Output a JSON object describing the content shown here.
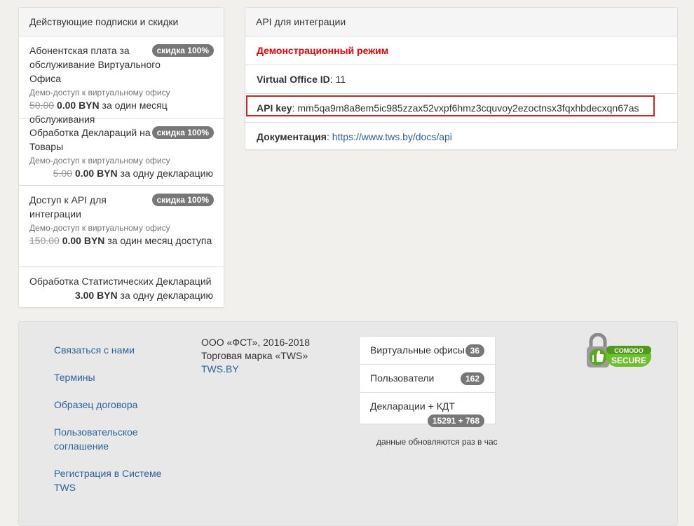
{
  "subscriptions": {
    "heading": "Действующие подписки и скидки",
    "items": [
      {
        "title": "Абонентская плата за обслуживание Виртуального Офиса",
        "badge": "скидка 100%",
        "note": "Демо-доступ к виртуальному офису",
        "old_price": "50.00",
        "new_price": "0.00 BYN",
        "period": "за один месяц обслуживания"
      },
      {
        "title": "Обработка Деклараций на Товары",
        "badge": "скидка 100%",
        "note": "Демо-доступ к виртуальному офису",
        "old_price": "5.00",
        "new_price": "0.00 BYN",
        "period": "за одну декларацию"
      },
      {
        "title": "Доступ к API для интеграции",
        "badge": "скидка 100%",
        "note": "Демо-доступ к виртуальному офису",
        "old_price": "150.00",
        "new_price": "0.00 BYN",
        "period": "за один месяц доступа"
      },
      {
        "title": "Обработка Статистических Деклараций",
        "new_price": "3.00 BYN",
        "period": "за одну декларацию"
      }
    ]
  },
  "api": {
    "heading": "API для интеграции",
    "demo_mode": "Демонстрационный режим",
    "vo_label": "Virtual Office ID",
    "vo_value": "11",
    "key_label": "API key",
    "key_value": "mm5qa9m8a8em5ic985zzax52vxpf6hmz3cquvoy2ezoctnsx3fqxhbdecxqn67as",
    "docs_label": "Документация",
    "docs_link": "https://www.tws.by/docs/api",
    "highlight_color": "#d0271d"
  },
  "footer": {
    "links": [
      "Связаться с нами",
      "Термины",
      "Образец договора",
      "Пользовательское соглашение",
      "Регистрация в Системе TWS"
    ],
    "copyright": "ООО «ФСТ», 2016-2018",
    "trademark": "Торговая марка «TWS»",
    "site_link": "TWS.BY",
    "stats": [
      {
        "label": "Виртуальные офисы",
        "value": "36"
      },
      {
        "label": "Пользователи",
        "value": "162"
      },
      {
        "label": "Декларации + КДТ",
        "value": "15291 + 768"
      }
    ],
    "stats_note": "данные обновляются раз в час",
    "comodo": {
      "brand": "COMODO",
      "text": "SECURE"
    }
  }
}
